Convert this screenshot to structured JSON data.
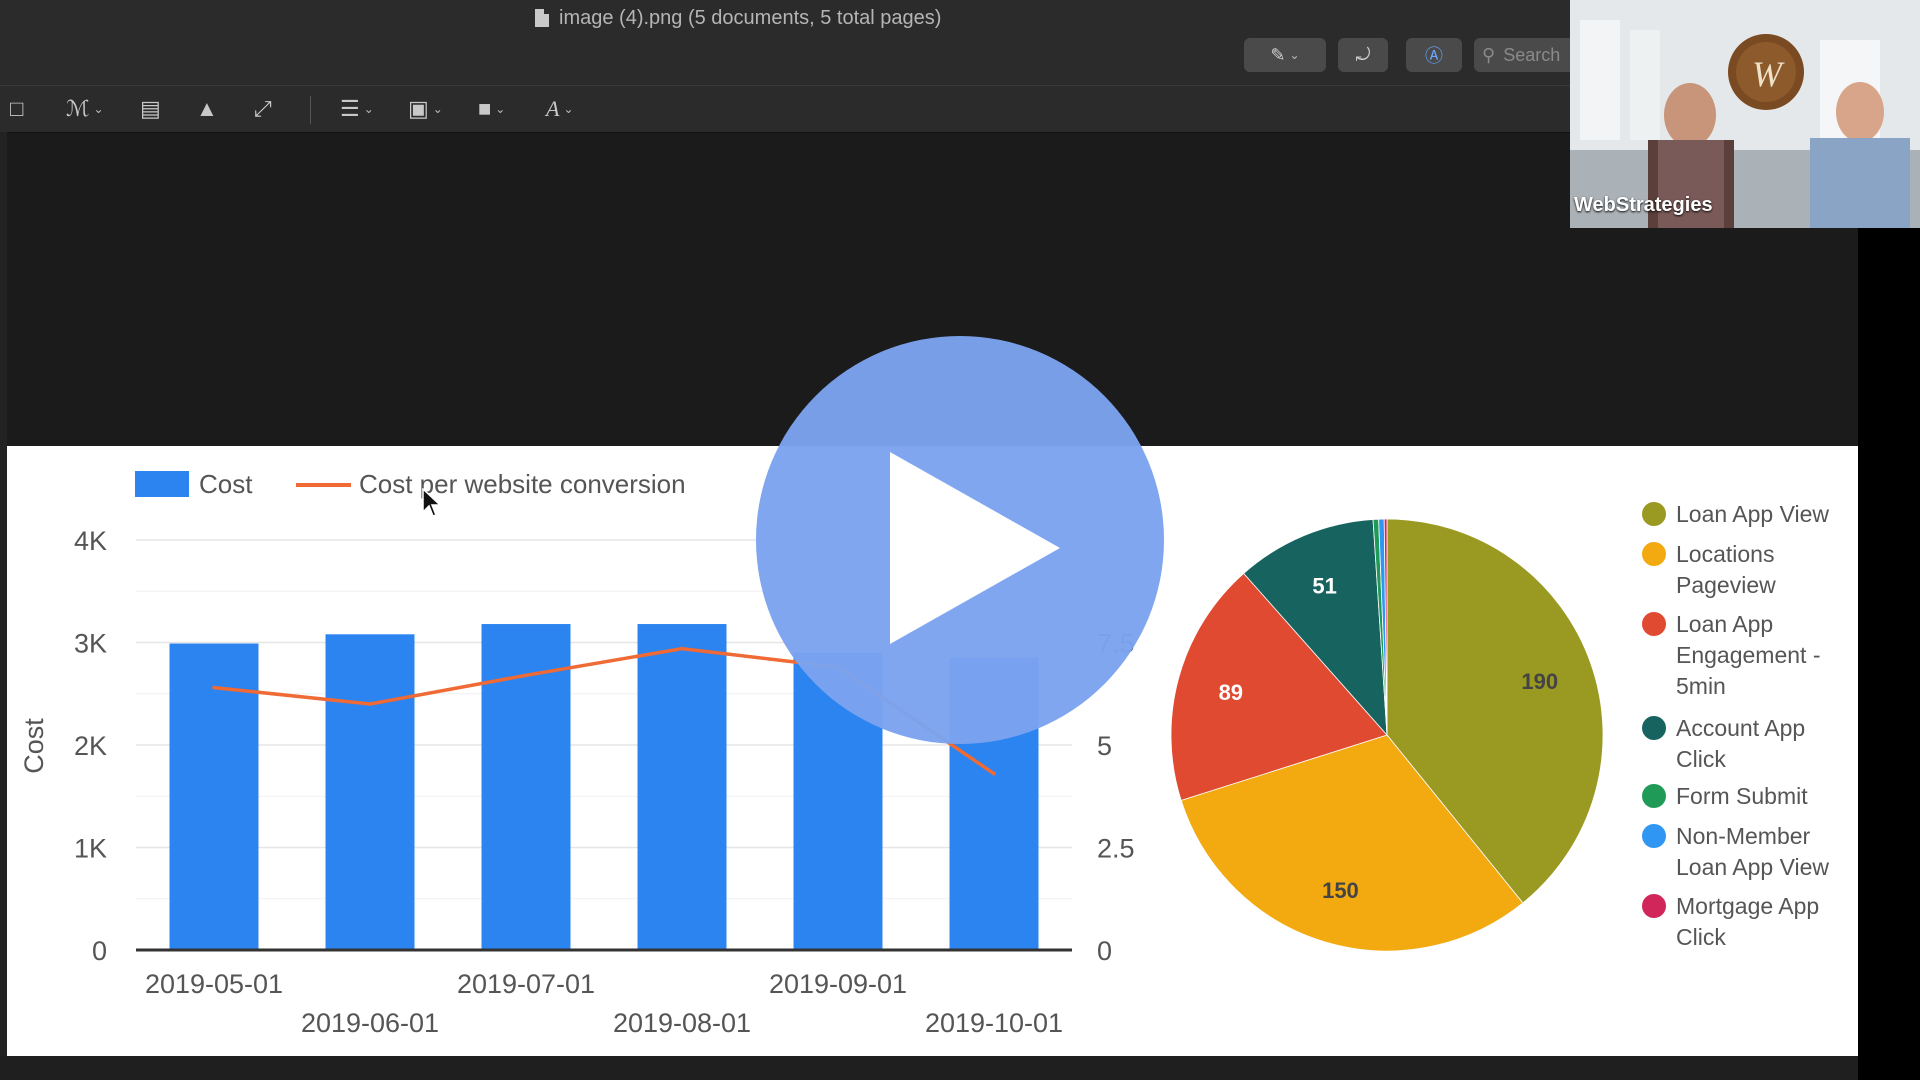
{
  "window": {
    "title": "image (4).png (5 documents, 5 total pages)",
    "search_placeholder": "Search"
  },
  "webcam": {
    "brand_label": "WebStrategies"
  },
  "colors": {
    "bar": "#2b84f0",
    "line": "#ef6a35",
    "loan_app_view": "#9a9a22",
    "locations_pageview": "#f2aa10",
    "loan_app_engagement": "#e04a31",
    "account_app_click": "#176360",
    "form_submit": "#1f9b57",
    "non_member": "#2f96f3",
    "mortgage": "#d0265a"
  },
  "chart_data": [
    {
      "type": "bar",
      "legend": [
        "Cost",
        "Cost per website conversion"
      ],
      "categories": [
        "2019-05-01",
        "2019-06-01",
        "2019-07-01",
        "2019-08-01",
        "2019-09-01",
        "2019-10-01"
      ],
      "series": [
        {
          "name": "Cost",
          "values": [
            2990,
            3080,
            3180,
            3180,
            2900,
            2850
          ]
        },
        {
          "name": "Cost per website conversion",
          "values": [
            6.4,
            6.0,
            6.7,
            7.35,
            6.9,
            4.3
          ]
        }
      ],
      "ylabel": "Cost",
      "ylim": [
        0,
        4000
      ],
      "yticks": [
        "0",
        "1K",
        "2K",
        "3K",
        "4K"
      ],
      "y2lim": [
        0,
        10
      ],
      "y2ticks": [
        "0",
        "2.5",
        "5",
        "7.5"
      ],
      "grid": true,
      "legend_position": "top-left"
    },
    {
      "type": "pie",
      "labels": [
        "Loan App View",
        "Locations Pageview",
        "Loan App Engagement - 5min",
        "Account App Click",
        "Form Submit",
        "Non-Member Loan App View",
        "Mortgage App Click"
      ],
      "values": [
        190,
        150,
        89,
        51,
        2,
        2,
        1
      ],
      "data_labels": [
        "190",
        "150",
        "89",
        "51",
        "",
        "",
        ""
      ],
      "legend_position": "right"
    }
  ]
}
